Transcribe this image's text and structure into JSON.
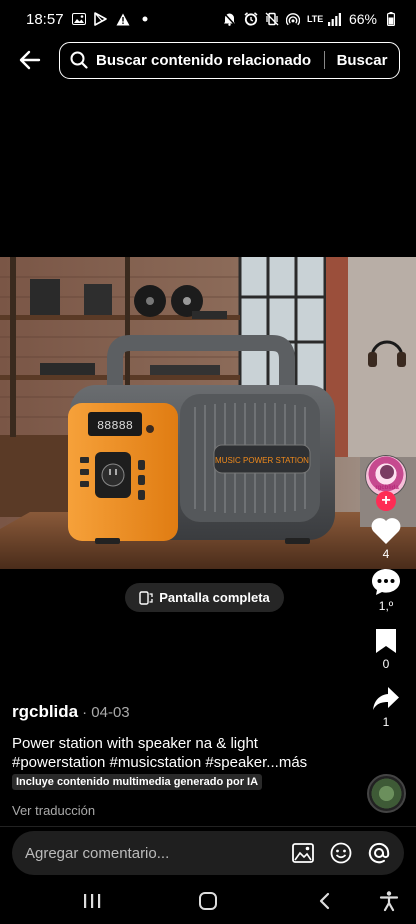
{
  "status_bar": {
    "time": "18:57",
    "network": "LTE",
    "battery": "66%",
    "left_icons": [
      "image-icon",
      "play-store-icon",
      "warning-icon",
      "dot-icon"
    ],
    "right_icons": [
      "mute-icon",
      "alarm-icon",
      "vibrate-icon",
      "hotspot-icon",
      "signal-icon",
      "battery-icon"
    ]
  },
  "search": {
    "placeholder": "Buscar contenido relacionado",
    "button_label": "Buscar"
  },
  "video": {
    "fullscreen_label": "Pantalla completa",
    "product_label": "MUSIC POWER STATION",
    "display_reading": "88888"
  },
  "side_actions": {
    "avatar_text": "rgcblida",
    "likes": "4",
    "comments": "1,º",
    "saves": "0",
    "shares": "1"
  },
  "caption": {
    "author": "rgcblida",
    "date": "· 04-03",
    "text_line1": "Power station with speaker na & light",
    "text_line2": "#powerstation #musicstation #speaker...",
    "more_label": "más",
    "ai_label": "Incluye contenido multimedia generado por IA",
    "translate_label": "Ver traducción"
  },
  "comment_bar": {
    "placeholder": "Agregar comentario..."
  },
  "colors": {
    "accent_pink": "#fe2c55",
    "device_orange": "#f08a1c"
  }
}
